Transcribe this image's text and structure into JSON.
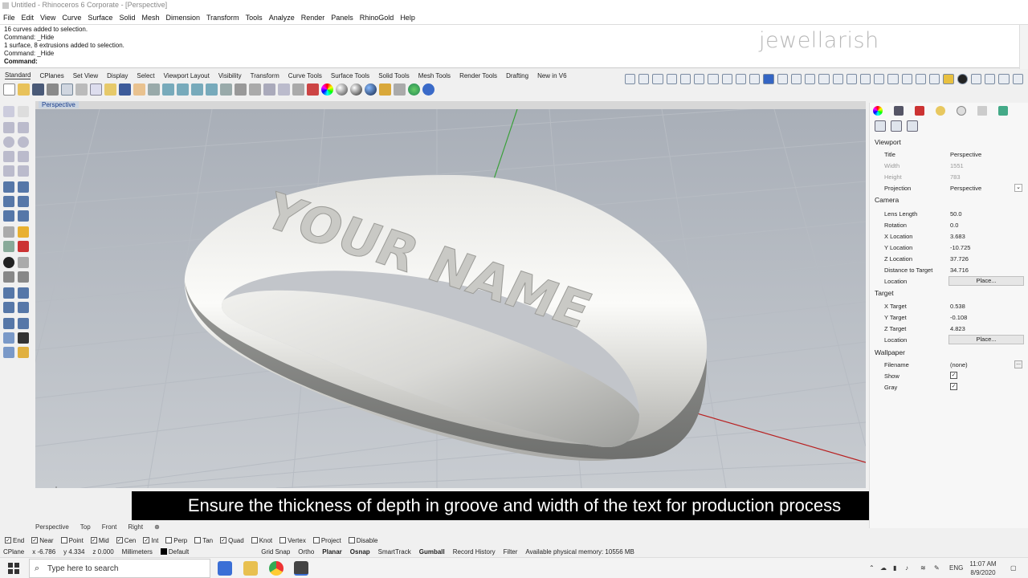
{
  "titlebar": {
    "text": "Untitled - Rhinoceros 6 Corporate - [Perspective]"
  },
  "menu": [
    "File",
    "Edit",
    "View",
    "Curve",
    "Surface",
    "Solid",
    "Mesh",
    "Dimension",
    "Transform",
    "Tools",
    "Analyze",
    "Render",
    "Panels",
    "RhinoGold",
    "Help"
  ],
  "command_history": [
    "16 curves added to selection.",
    "Command: _Hide",
    "1 surface, 8 extrusions added to selection.",
    "Command: _Hide",
    "Command:"
  ],
  "watermark": "jewellarish",
  "toolbar_tabs": [
    "Standard",
    "CPlanes",
    "Set View",
    "Display",
    "Select",
    "Viewport Layout",
    "Visibility",
    "Transform",
    "Curve Tools",
    "Surface Tools",
    "Solid Tools",
    "Mesh Tools",
    "Render Tools",
    "Drafting",
    "New in V6"
  ],
  "viewport": {
    "label": "Perspective",
    "engraving": "YOUR NAME"
  },
  "view_tabs": [
    "Perspective",
    "Top",
    "Front",
    "Right"
  ],
  "subtitle": "Ensure the thickness of depth in groove and width of the text for production process",
  "osnaps": [
    {
      "label": "End",
      "checked": true
    },
    {
      "label": "Near",
      "checked": true
    },
    {
      "label": "Point",
      "checked": false
    },
    {
      "label": "Mid",
      "checked": true
    },
    {
      "label": "Cen",
      "checked": true
    },
    {
      "label": "Int",
      "checked": true
    },
    {
      "label": "Perp",
      "checked": false
    },
    {
      "label": "Tan",
      "checked": false
    },
    {
      "label": "Quad",
      "checked": true
    },
    {
      "label": "Knot",
      "checked": false
    },
    {
      "label": "Vertex",
      "checked": false
    },
    {
      "label": "Project",
      "checked": false
    },
    {
      "label": "Disable",
      "checked": false
    }
  ],
  "status": {
    "cplane": "CPlane",
    "x": "x -6.786",
    "y": "y 4.334",
    "z": "z 0.000",
    "units": "Millimeters",
    "layer": "Default",
    "toggles": [
      "Grid Snap",
      "Ortho",
      "Planar",
      "Osnap",
      "SmartTrack",
      "Gumball",
      "Record History",
      "Filter"
    ],
    "memory": "Available physical memory: 10556 MB"
  },
  "panel": {
    "viewport_section": "Viewport",
    "title_label": "Title",
    "title_value": "Perspective",
    "width_label": "Width",
    "width_value": "1551",
    "height_label": "Height",
    "height_value": "783",
    "projection_label": "Projection",
    "projection_value": "Perspective",
    "camera_section": "Camera",
    "lens_label": "Lens Length",
    "lens_value": "50.0",
    "rotation_label": "Rotation",
    "rotation_value": "0.0",
    "xloc_label": "X Location",
    "xloc_value": "3.683",
    "yloc_label": "Y Location",
    "yloc_value": "-10.725",
    "zloc_label": "Z Location",
    "zloc_value": "37.726",
    "dist_label": "Distance to Target",
    "dist_value": "34.716",
    "loc_label": "Location",
    "place_button": "Place...",
    "target_section": "Target",
    "xt_label": "X Target",
    "xt_value": "0.538",
    "yt_label": "Y Target",
    "yt_value": "-0.108",
    "zt_label": "Z Target",
    "zt_value": "4.823",
    "tloc_label": "Location",
    "tplace_button": "Place...",
    "wallpaper_section": "Wallpaper",
    "filename_label": "Filename",
    "filename_value": "(none)",
    "show_label": "Show",
    "gray_label": "Gray"
  },
  "taskbar": {
    "search_placeholder": "Type here to search",
    "language": "ENG",
    "time": "11:07 AM",
    "date": "8/9/2020"
  }
}
